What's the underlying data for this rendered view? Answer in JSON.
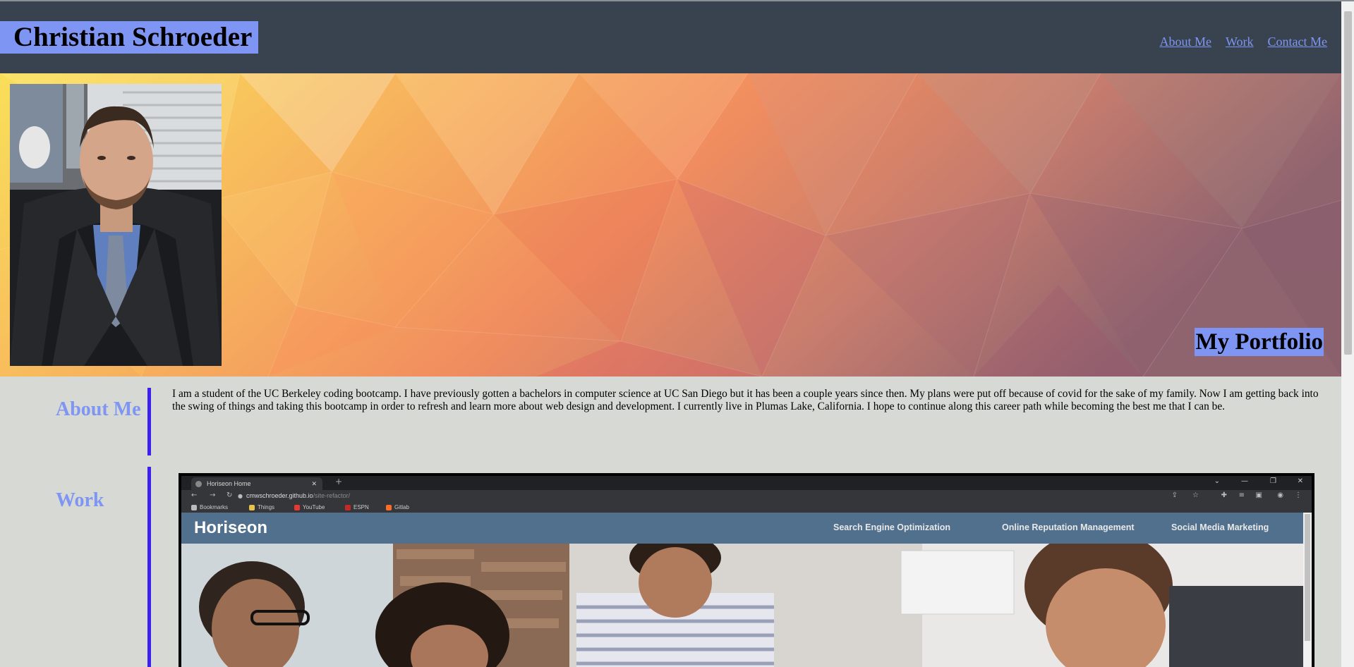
{
  "header": {
    "title": "Christian Schroeder",
    "nav": [
      "About Me",
      "Work",
      "Contact Me"
    ]
  },
  "hero": {
    "tagline": "My Portfolio"
  },
  "about": {
    "heading": "About Me",
    "text": "I am a student of the UC Berkeley coding bootcamp. I have previously gotten a bachelors in computer science at UC San Diego but it has been a couple years since then. My plans were put off because of covid for the sake of my family. Now I am getting back into the swing of things and taking this bootcamp in order to refresh and learn more about web design and development. I currently live in Plumas Lake, California. I hope to continue along this career path while becoming the best me that I can be."
  },
  "work": {
    "heading": "Work",
    "screenshot": {
      "tab_title": "Horiseon Home",
      "url_host": "cmwschroeder.github.io",
      "url_path": "/site-refactor/",
      "bookmarks": [
        "Bookmarks",
        "Things",
        "YouTube",
        "ESPN",
        "Gitlab"
      ],
      "site_logo": "Horiseon",
      "site_nav": [
        "Search Engine Optimization",
        "Online Reputation Management",
        "Social Media Marketing"
      ]
    }
  },
  "colors": {
    "header_bg": "#38434f",
    "accent": "#7f95f3",
    "divider": "#3d1ff2",
    "page_bg": "#d6d9d4"
  },
  "icons": [
    "avatar-photo",
    "browser-back-icon",
    "browser-forward-icon",
    "browser-reload-icon",
    "lock-icon",
    "star-icon"
  ]
}
